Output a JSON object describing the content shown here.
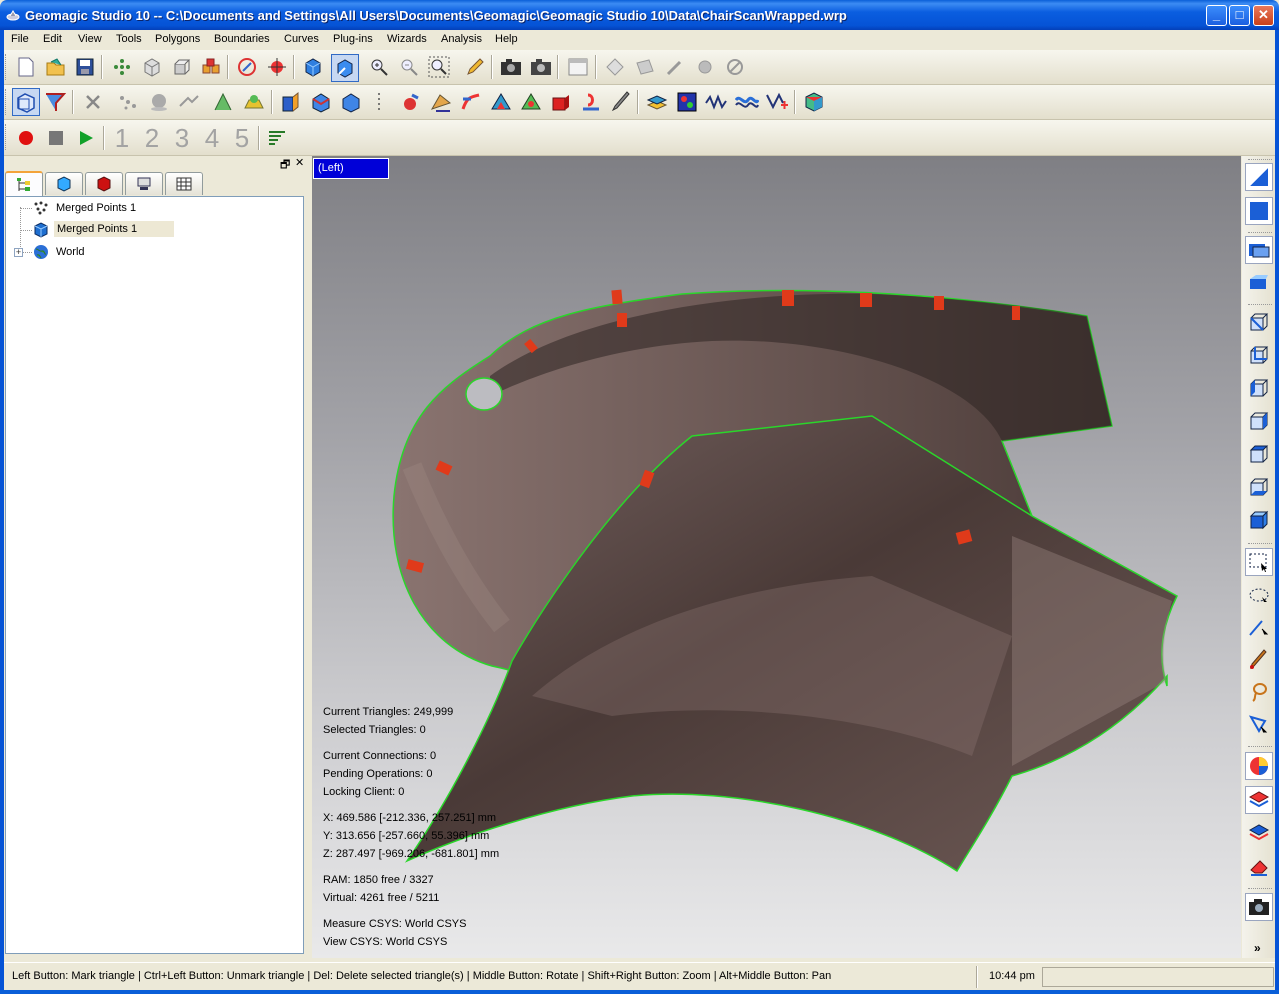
{
  "window": {
    "title": "Geomagic Studio 10 -- C:\\Documents and Settings\\All Users\\Documents\\Geomagic\\Geomagic Studio 10\\Data\\ChairScanWrapped.wrp",
    "minimize_label": "_",
    "maximize_label": "□",
    "close_label": "✕"
  },
  "menu": [
    "File",
    "Edit",
    "View",
    "Tools",
    "Polygons",
    "Boundaries",
    "Curves",
    "Plug-ins",
    "Wizards",
    "Analysis",
    "Help"
  ],
  "macro_toolbar": {
    "numbers": [
      "1",
      "2",
      "3",
      "4",
      "5"
    ]
  },
  "left_panel": {
    "restore_label": "🗗",
    "close_label": "✕",
    "tree": [
      {
        "label": "Merged Points 1",
        "icon": "point-cloud-icon",
        "selected": false
      },
      {
        "label": "Merged Points 1",
        "icon": "polygon-object-icon",
        "selected": true
      },
      {
        "label": "World",
        "icon": "globe-icon",
        "selected": false,
        "expander": "+"
      }
    ]
  },
  "viewport": {
    "view_name": "(Left)",
    "stats": {
      "current_triangles": "Current Triangles: 249,999",
      "selected_triangles": "Selected Triangles: 0",
      "current_connections": "Current Connections: 0",
      "pending_operations": "Pending Operations: 0",
      "locking_client": "Locking Client: 0",
      "x": "X: 469.586 [-212.336, 257.251] mm",
      "y": "Y: 313.656 [-257.660, 55.396] mm",
      "z": "Z: 287.497 [-969.206, -681.801] mm",
      "ram": "RAM: 1850 free / 3327",
      "virtual": "Virtual: 4261 free / 5211",
      "measure_csys": "Measure CSYS: World CSYS",
      "view_csys": "View CSYS: World CSYS"
    },
    "colors": {
      "mesh": "#4a3a36",
      "boundary": "#22dd22",
      "marker": "#e03a1a"
    }
  },
  "right_toolbar": {
    "more_label": "»"
  },
  "status": {
    "message": "Left Button: Mark triangle | Ctrl+Left Button: Unmark triangle | Del: Delete selected triangle(s) | Middle Button: Rotate | Shift+Right Button: Zoom | Alt+Middle Button: Pan",
    "time": "10:44 pm"
  }
}
